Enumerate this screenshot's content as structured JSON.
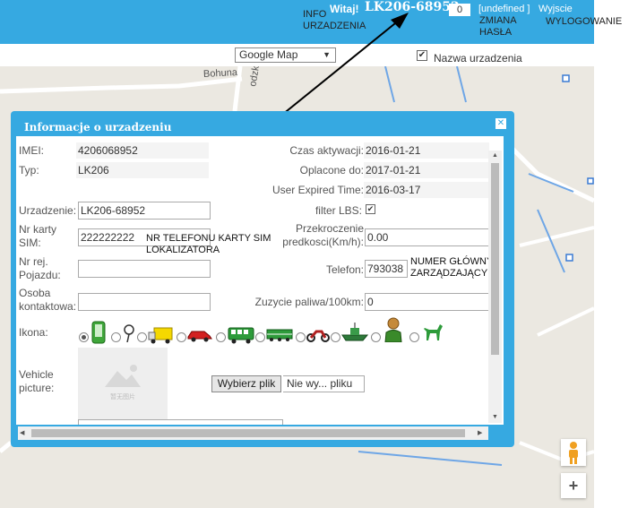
{
  "header": {
    "annotation_info": "INFO URZADZENIA",
    "greeting": "Witaj!",
    "device_name": "LK206-68952",
    "counter": "0",
    "undefined_text": "[undefined ]",
    "logout": "Wyjscie",
    "annotation_change_password": "ZMIANA HASŁA",
    "annotation_logout": "WYLOGOWANIE"
  },
  "map": {
    "type_selected": "Google Map",
    "show_name_label": "Nazwa urzadzenia",
    "show_name_checked": true,
    "street_labels": [
      "Bohuna",
      "odzka"
    ],
    "zoom_in": "+"
  },
  "dialog": {
    "title": "Informacje o urzadzeniu",
    "close": "✕",
    "fields": {
      "imei_label": "IMEI:",
      "imei_value": "4206068952",
      "type_label": "Typ:",
      "type_value": "LK206",
      "activation_label": "Czas aktywacji:",
      "activation_value": "2016-01-21",
      "paid_label": "Oplacone do:",
      "paid_value": "2017-01-21",
      "user_expired_label": "User Expired Time:",
      "user_expired_value": "2016-03-17",
      "device_label": "Urzadzenie:",
      "device_value": "LK206-68952",
      "filter_lbs_label": "filter LBS:",
      "filter_lbs_checked": true,
      "sim_label": "Nr karty SIM:",
      "sim_value": "222222222",
      "speed_label": "Przekroczenie predkosci(Km/h):",
      "speed_value": "0.00",
      "plate_label": "Nr rej. Pojazdu:",
      "plate_value": "",
      "phone_label": "Telefon:",
      "phone_value": "793038",
      "contact_label": "Osoba kontaktowa:",
      "contact_value": "",
      "fuel_label": "Zuzycie paliwa/100km:",
      "fuel_value": "0",
      "icon_label": "Ikona:",
      "picture_label": "Vehicle picture:",
      "picture_placeholder": "暂无图片",
      "choose_file": "Wybierz plik",
      "no_file": "Nie wy... pliku"
    },
    "annotations": {
      "sim": "NR TELEFONU KARTY SIM LOKALIZATORA",
      "phone": "NUMER GŁÓWNY ZARZĄDZAJĄCY"
    },
    "icons": [
      {
        "name": "phone-icon",
        "selected": true
      },
      {
        "name": "pin-icon",
        "selected": false
      },
      {
        "name": "truck-icon",
        "selected": false
      },
      {
        "name": "car-icon",
        "selected": false
      },
      {
        "name": "bus-icon",
        "selected": false
      },
      {
        "name": "train-icon",
        "selected": false
      },
      {
        "name": "motorcycle-icon",
        "selected": false
      },
      {
        "name": "boat-icon",
        "selected": false
      },
      {
        "name": "person-icon",
        "selected": false
      },
      {
        "name": "dog-icon",
        "selected": false
      }
    ]
  },
  "colors": {
    "accent": "#36a9e1",
    "map_bg": "#ebe8e1"
  }
}
